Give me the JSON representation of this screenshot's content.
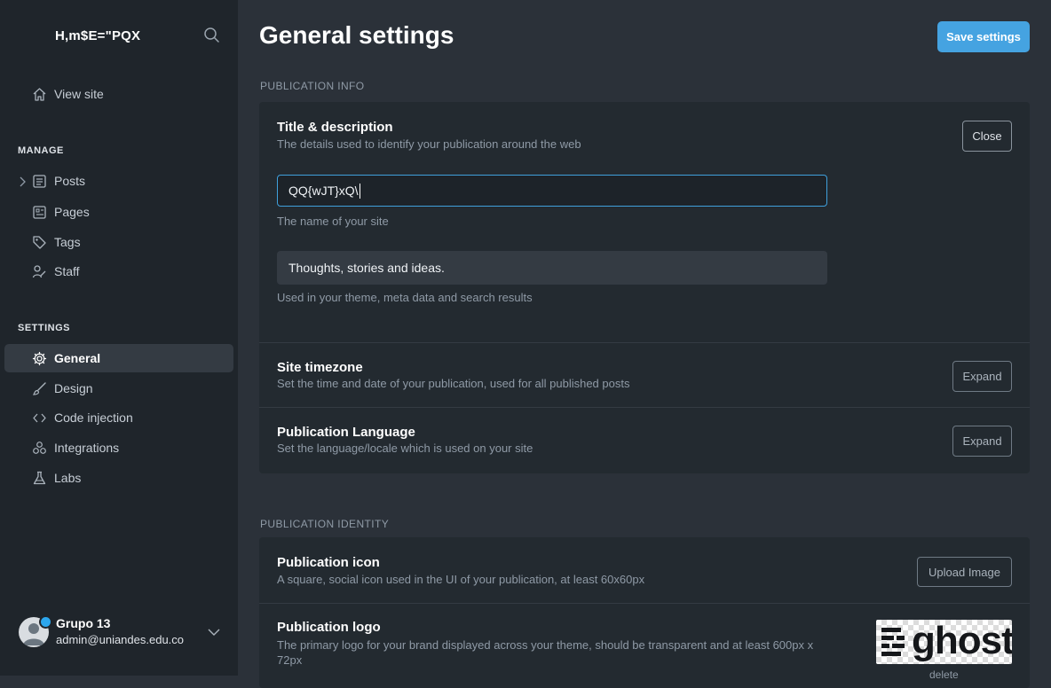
{
  "sidebar": {
    "site_title": "H,m$E=\"PQX",
    "view_site": "View site",
    "manage_label": "MANAGE",
    "manage_items": [
      {
        "label": "Posts",
        "icon": "posts-icon"
      },
      {
        "label": "Pages",
        "icon": "pages-icon"
      },
      {
        "label": "Tags",
        "icon": "tag-icon"
      },
      {
        "label": "Staff",
        "icon": "staff-icon"
      }
    ],
    "settings_label": "SETTINGS",
    "settings_items": [
      {
        "label": "General",
        "icon": "gear-icon",
        "active": true
      },
      {
        "label": "Design",
        "icon": "brush-icon"
      },
      {
        "label": "Code injection",
        "icon": "code-icon"
      },
      {
        "label": "Integrations",
        "icon": "integrations-icon"
      },
      {
        "label": "Labs",
        "icon": "flask-icon"
      }
    ],
    "user": {
      "name": "Grupo 13",
      "email": "admin@uniandes.edu.co"
    }
  },
  "header": {
    "title": "General settings",
    "save_label": "Save settings"
  },
  "publication_info": {
    "label": "PUBLICATION INFO",
    "title_desc": {
      "title": "Title & description",
      "desc": "The details used to identify your publication around the web",
      "close_label": "Close",
      "site_name_value": "QQ{wJT}xQ\\",
      "site_name_hint": "The name of your site",
      "description_value": "Thoughts, stories and ideas.",
      "description_hint": "Used in your theme, meta data and search results"
    },
    "timezone": {
      "title": "Site timezone",
      "desc": "Set the time and date of your publication, used for all published posts",
      "button": "Expand"
    },
    "language": {
      "title": "Publication Language",
      "desc": "Set the language/locale which is used on your site",
      "button": "Expand"
    }
  },
  "publication_identity": {
    "label": "PUBLICATION IDENTITY",
    "icon": {
      "title": "Publication icon",
      "desc": "A square, social icon used in the UI of your publication, at least 60x60px",
      "button": "Upload Image"
    },
    "logo": {
      "title": "Publication logo",
      "desc": "The primary logo for your brand displayed across your theme, should be transparent and at least 600px x 72px",
      "logo_text": "ghost",
      "delete_label": "delete"
    }
  },
  "colors": {
    "accent": "#45a3e1",
    "sidebar_bg": "#1f252b",
    "main_bg": "#2b3139",
    "card_bg": "#232a30"
  }
}
